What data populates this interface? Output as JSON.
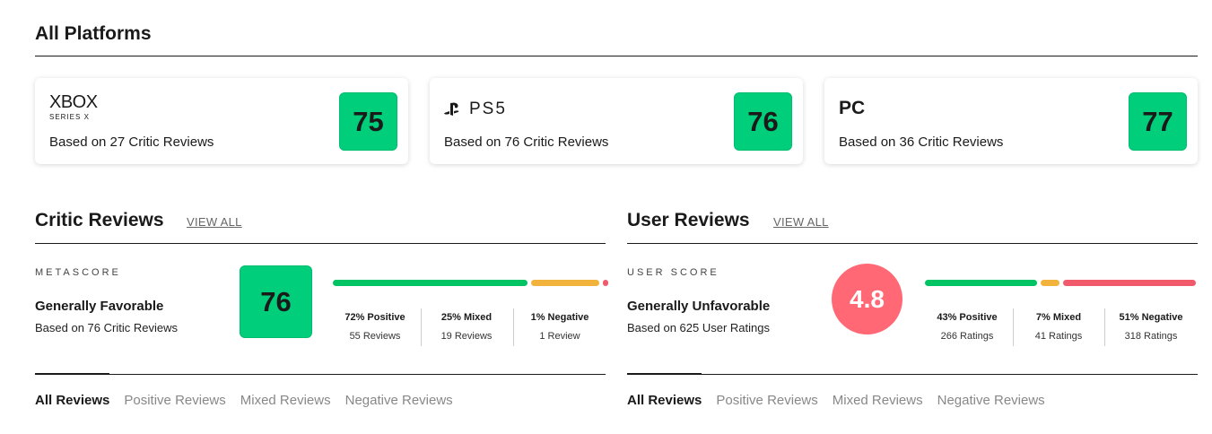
{
  "all_platforms": {
    "title": "All Platforms",
    "cards": [
      {
        "platform_line1": "XBOX",
        "platform_line2": "SERIES X",
        "based_on": "Based on 27 Critic Reviews",
        "score": "75",
        "score_color": "#00ce7a"
      },
      {
        "platform_label": "PS5",
        "based_on": "Based on 76 Critic Reviews",
        "score": "76",
        "score_color": "#00ce7a"
      },
      {
        "platform_label": "PC",
        "based_on": "Based on 36 Critic Reviews",
        "score": "77",
        "score_color": "#00ce7a"
      }
    ]
  },
  "critic": {
    "title": "Critic Reviews",
    "view_all": "VIEW ALL",
    "score_label": "METASCORE",
    "verdict": "Generally Favorable",
    "based_on": "Based on 76 Critic Reviews",
    "score": "76",
    "distribution": [
      {
        "label": "72% Positive",
        "count": "55 Reviews",
        "percent": 72,
        "color": "#00c464"
      },
      {
        "label": "25% Mixed",
        "count": "19 Reviews",
        "percent": 25,
        "color": "#f2b33d"
      },
      {
        "label": "1% Negative",
        "count": "1 Review",
        "percent": 1,
        "color": "#f05a6a"
      }
    ],
    "tabs": [
      "All Reviews",
      "Positive Reviews",
      "Mixed Reviews",
      "Negative Reviews"
    ]
  },
  "user": {
    "title": "User Reviews",
    "view_all": "VIEW ALL",
    "score_label": "USER SCORE",
    "verdict": "Generally Unfavorable",
    "based_on": "Based on 625 User Ratings",
    "score": "4.8",
    "score_color": "#ff6874",
    "distribution": [
      {
        "label": "43% Positive",
        "count": "266 Ratings",
        "percent": 43,
        "color": "#00c464"
      },
      {
        "label": "7% Mixed",
        "count": "41 Ratings",
        "percent": 7,
        "color": "#f2b33d"
      },
      {
        "label": "51% Negative",
        "count": "318 Ratings",
        "percent": 51,
        "color": "#f05a6a"
      }
    ],
    "tabs": [
      "All Reviews",
      "Positive Reviews",
      "Mixed Reviews",
      "Negative Reviews"
    ]
  },
  "colors": {
    "favorable": "#00ce7a",
    "mixed": "#f2b33d",
    "unfavorable": "#ff6874"
  }
}
